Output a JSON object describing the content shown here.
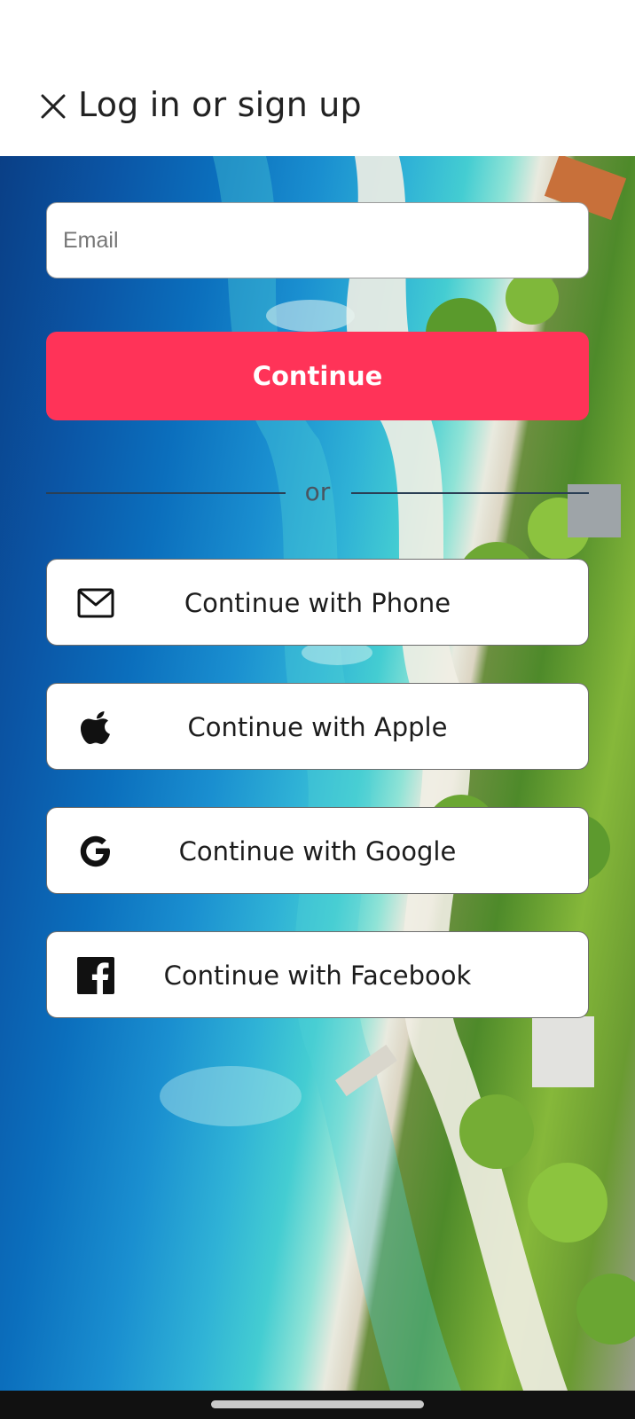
{
  "header": {
    "title": "Log in or sign up",
    "close_icon": "close-icon"
  },
  "form": {
    "email_placeholder": "Email",
    "email_value": "",
    "continue_label": "Continue",
    "divider_text": "or"
  },
  "social": [
    {
      "id": "phone",
      "label": "Continue with Phone",
      "icon": "envelope-icon"
    },
    {
      "id": "apple",
      "label": "Continue with Apple",
      "icon": "apple-icon"
    },
    {
      "id": "google",
      "label": "Continue with Google",
      "icon": "google-icon"
    },
    {
      "id": "facebook",
      "label": "Continue with Facebook",
      "icon": "facebook-icon"
    }
  ],
  "colors": {
    "accent": "#ff3358",
    "text": "#222222",
    "button_border": "#6d6d6d",
    "background_photo": "aerial beach coastline"
  }
}
